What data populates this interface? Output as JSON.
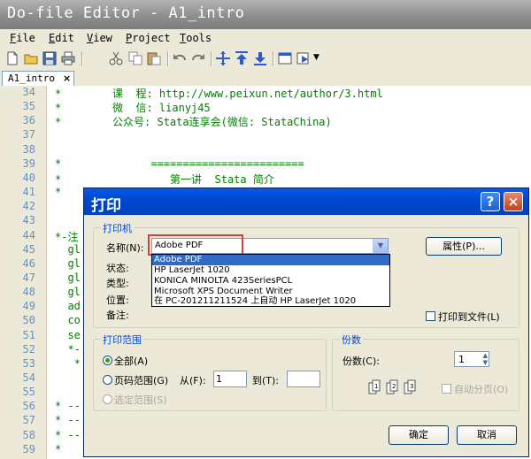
{
  "window": {
    "title": "Do-file Editor - A1_intro"
  },
  "menu": [
    {
      "key": "F",
      "rest": "ile"
    },
    {
      "key": "E",
      "rest": "dit"
    },
    {
      "key": "V",
      "rest": "iew"
    },
    {
      "key": "P",
      "rest": "roject"
    },
    {
      "key": "T",
      "rest": "ools"
    }
  ],
  "toolbar_icons": [
    "new-file-icon",
    "open-folder-icon",
    "save-icon",
    "print-icon",
    "cut-icon",
    "copy-icon",
    "paste-icon",
    "undo-icon",
    "redo-icon",
    "find-icon",
    "shift-up-icon",
    "shift-down-icon",
    "run-icon",
    "do-icon"
  ],
  "tab": {
    "label": "A1_intro",
    "close": "×"
  },
  "editor": {
    "line_numbers": [
      "34",
      "35",
      "36",
      "37",
      "38",
      "39",
      "40",
      "41",
      "42",
      "43",
      "44",
      "45",
      "46",
      "47",
      "48",
      "49",
      "50",
      "51",
      "52",
      "53",
      "54",
      "55",
      "56",
      "57",
      "58",
      "59"
    ],
    "lines": [
      "*        课  程: http://www.peixun.net/author/3.html",
      "*        微  信: lianyj45",
      "*        公众号: Stata连享会(微信: StataChina)",
      "",
      "",
      "*              ========================",
      "*                 第一讲  Stata 简介",
      "*",
      "",
      "",
      "*-注",
      "  gl",
      "  gl",
      "  gl",
      "  gl",
      "  ad",
      "  co",
      "  se",
      "  *-",
      "   *",
      "",
      "",
      "* --",
      "* --",
      "* --",
      "*"
    ]
  },
  "dialog": {
    "title": "打印",
    "help": "?",
    "close": "×",
    "printer_group": "打印机",
    "name_label": "名称(N):",
    "printer_value": "Adobe PDF",
    "properties_btn": "属性(P)...",
    "status_label": "状态:",
    "type_label": "类型:",
    "where_label": "位置:",
    "comment_label": "备注:",
    "print_to_file": "打印到文件(L)",
    "printers": [
      "Adobe PDF",
      "HP LaserJet 1020",
      "KONICA MINOLTA 423SeriesPCL",
      "Microsoft XPS Document Writer",
      "在 PC-201211211524 上自动 HP LaserJet 1020"
    ],
    "range_group": "打印范围",
    "all": "全部(A)",
    "pages": "页码范围(G)",
    "from": "从(F):",
    "from_value": "1",
    "to": "到(T):",
    "to_value": "",
    "selection": "选定范围(S)",
    "copies_group": "份数",
    "copies_label": "份数(C):",
    "copies_value": "1",
    "collate": "自动分页(O)",
    "ok": "确定",
    "cancel": "取消"
  },
  "colors": {
    "dialog_title": "#0048d0",
    "highlight": "#316ac5",
    "code": "#008000",
    "annotation": "#e03a3a"
  }
}
